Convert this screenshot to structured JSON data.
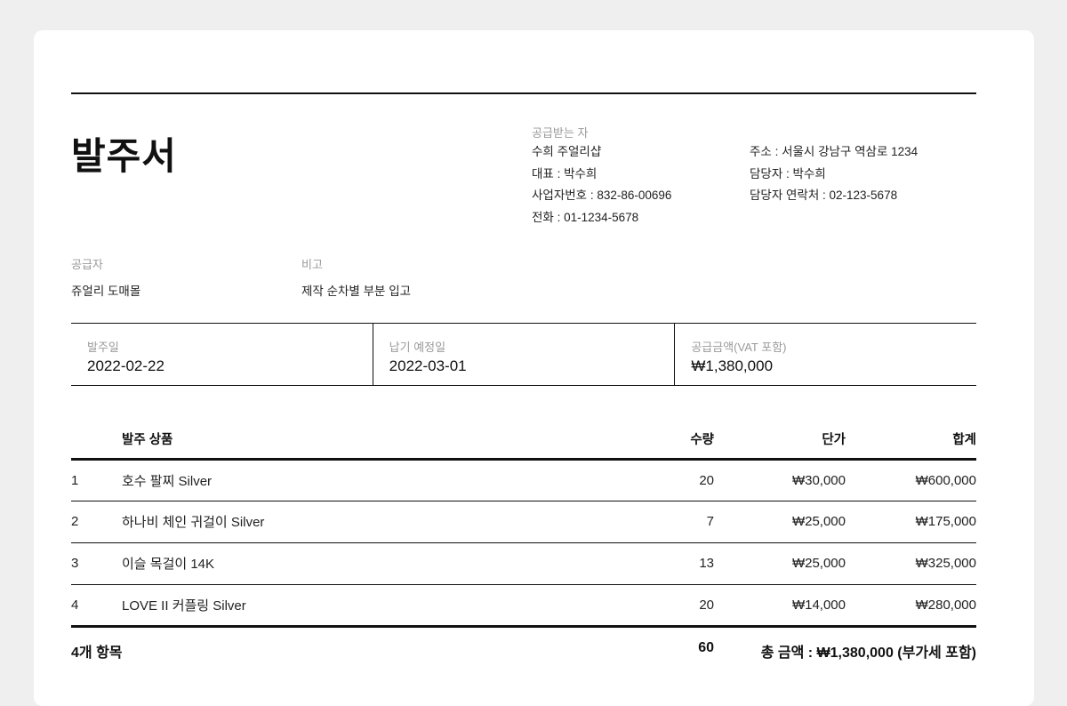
{
  "title": "발주서",
  "receiver": {
    "label": "공급받는 자",
    "left": [
      "수희 주얼리샵",
      "대표 : 박수희",
      "사업자번호 :  832-86-00696",
      "전화 : 01-1234-5678"
    ],
    "right": [
      "주소 : 서울시 강남구 역삼로 1234",
      "담당자 : 박수희",
      "담당자 연락처 : 02-123-5678"
    ]
  },
  "supplier": {
    "label": "공급자",
    "value": "쥬얼리 도매몰"
  },
  "note": {
    "label": "비고",
    "value": "제작 순차별 부분 입고"
  },
  "summary": {
    "order_date_label": "발주일",
    "order_date": "2022-02-22",
    "due_date_label": "납기 예정일",
    "due_date": "2022-03-01",
    "amount_label": "공급금액(VAT 포함)",
    "amount": "₩1,380,000"
  },
  "table": {
    "headers": {
      "product": "발주 상품",
      "qty": "수량",
      "unit": "단가",
      "total": "합계"
    },
    "rows": [
      {
        "no": "1",
        "product": "호수 팔찌 Silver",
        "qty": "20",
        "unit": "₩30,000",
        "total": "₩600,000"
      },
      {
        "no": "2",
        "product": "하나비 체인 귀걸이 Silver",
        "qty": "7",
        "unit": "₩25,000",
        "total": "₩175,000"
      },
      {
        "no": "3",
        "product": "이슬 목걸이 14K",
        "qty": "13",
        "unit": "₩25,000",
        "total": "₩325,000"
      },
      {
        "no": "4",
        "product": "LOVE II 커플링 Silver",
        "qty": "20",
        "unit": "₩14,000",
        "total": "₩280,000"
      }
    ]
  },
  "footer": {
    "count": "4개 항목",
    "qty": "60",
    "grand": "총 금액 : ₩1,380,000 (부가세 포함)"
  }
}
